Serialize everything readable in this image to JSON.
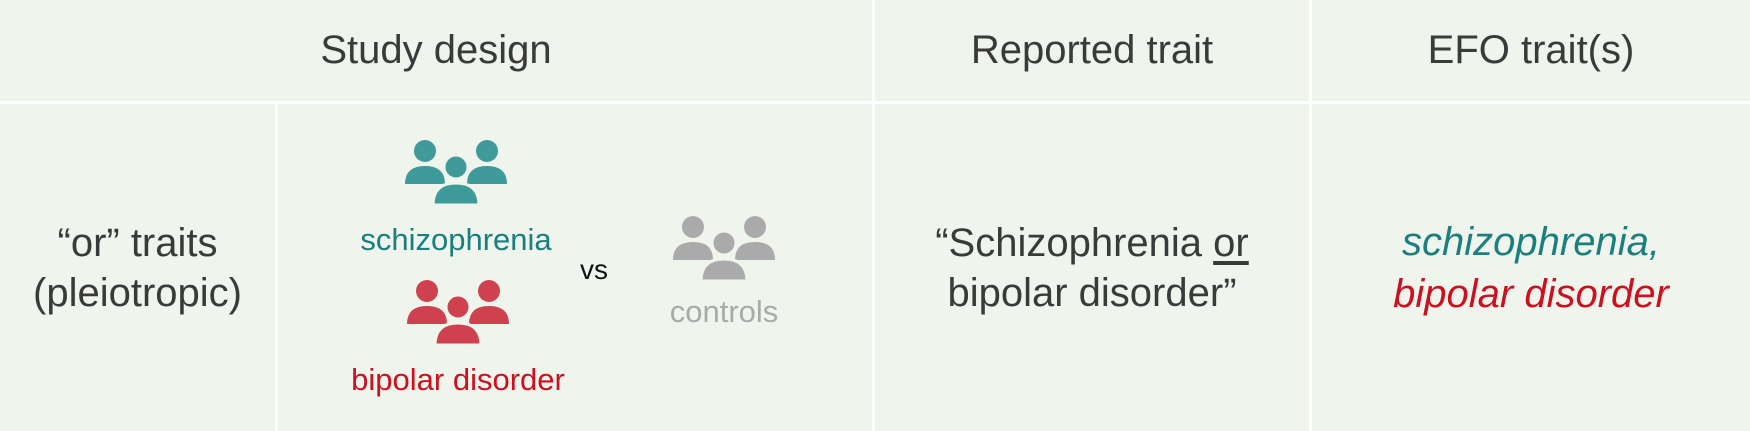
{
  "header": {
    "study_design": "Study design",
    "reported_trait": "Reported trait",
    "efo_traits": "EFO trait(s)"
  },
  "row": {
    "trait_type_line1": "“or” traits",
    "trait_type_line2": "(pleiotropic)",
    "group_a_label": "schizophrenia",
    "group_b_label": "bipolar disorder",
    "versus": "vs",
    "control_label": "controls",
    "reported_pre": "“Schizophrenia ",
    "reported_or": "or",
    "reported_line2": "bipolar disorder”",
    "efo_line1": "schizophrenia,",
    "efo_line2": "bipolar disorder"
  },
  "icons": {
    "group_a": "people-group-icon",
    "group_b": "people-group-icon",
    "controls": "people-group-icon"
  },
  "colors": {
    "background": "#eff4ec",
    "teal": "#1c7f7f",
    "teal_icon": "#3f9a9a",
    "red": "#cc1020",
    "red_icon": "#d0414f",
    "gray": "#aaaaaa",
    "text": "#3a3a3a"
  }
}
